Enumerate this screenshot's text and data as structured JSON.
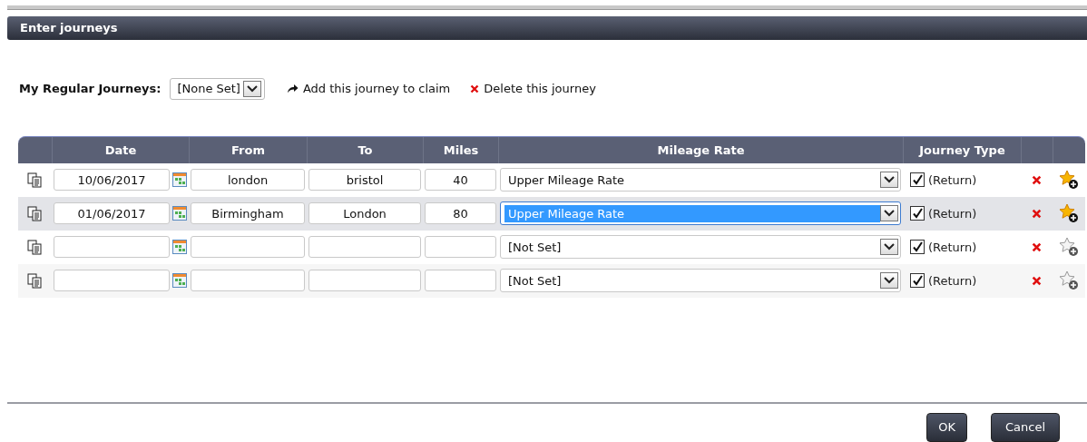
{
  "dialog": {
    "title": "Enter journeys"
  },
  "regular_journeys": {
    "label": "My Regular Journeys:",
    "value": "[None Set]"
  },
  "actions": [
    {
      "kind": "add",
      "label": "Add this journey to claim"
    },
    {
      "kind": "delete",
      "label": "Delete this journey"
    }
  ],
  "table": {
    "columns": [
      "Date",
      "From",
      "To",
      "Miles",
      "Mileage Rate",
      "Journey Type"
    ],
    "rows": [
      {
        "date": "10/06/2017",
        "from": "london",
        "to": "bristol",
        "miles": "40",
        "rate": "Upper Mileage Rate",
        "rate_focused": false,
        "return_checked": true,
        "return_label": "(Return)",
        "favourite": true,
        "selected": false
      },
      {
        "date": "01/06/2017",
        "from": "Birmingham",
        "to": "London",
        "miles": "80",
        "rate": "Upper Mileage Rate",
        "rate_focused": true,
        "return_checked": true,
        "return_label": "(Return)",
        "favourite": true,
        "selected": true
      },
      {
        "rate": "[Not Set]",
        "rate_focused": false,
        "return_checked": true,
        "return_label": "(Return)",
        "favourite": false,
        "selected": false
      },
      {
        "rate": "[Not Set]",
        "rate_focused": false,
        "return_checked": true,
        "return_label": "(Return)",
        "favourite": false,
        "selected": false
      }
    ]
  },
  "buttons": [
    "OK",
    "Cancel"
  ]
}
